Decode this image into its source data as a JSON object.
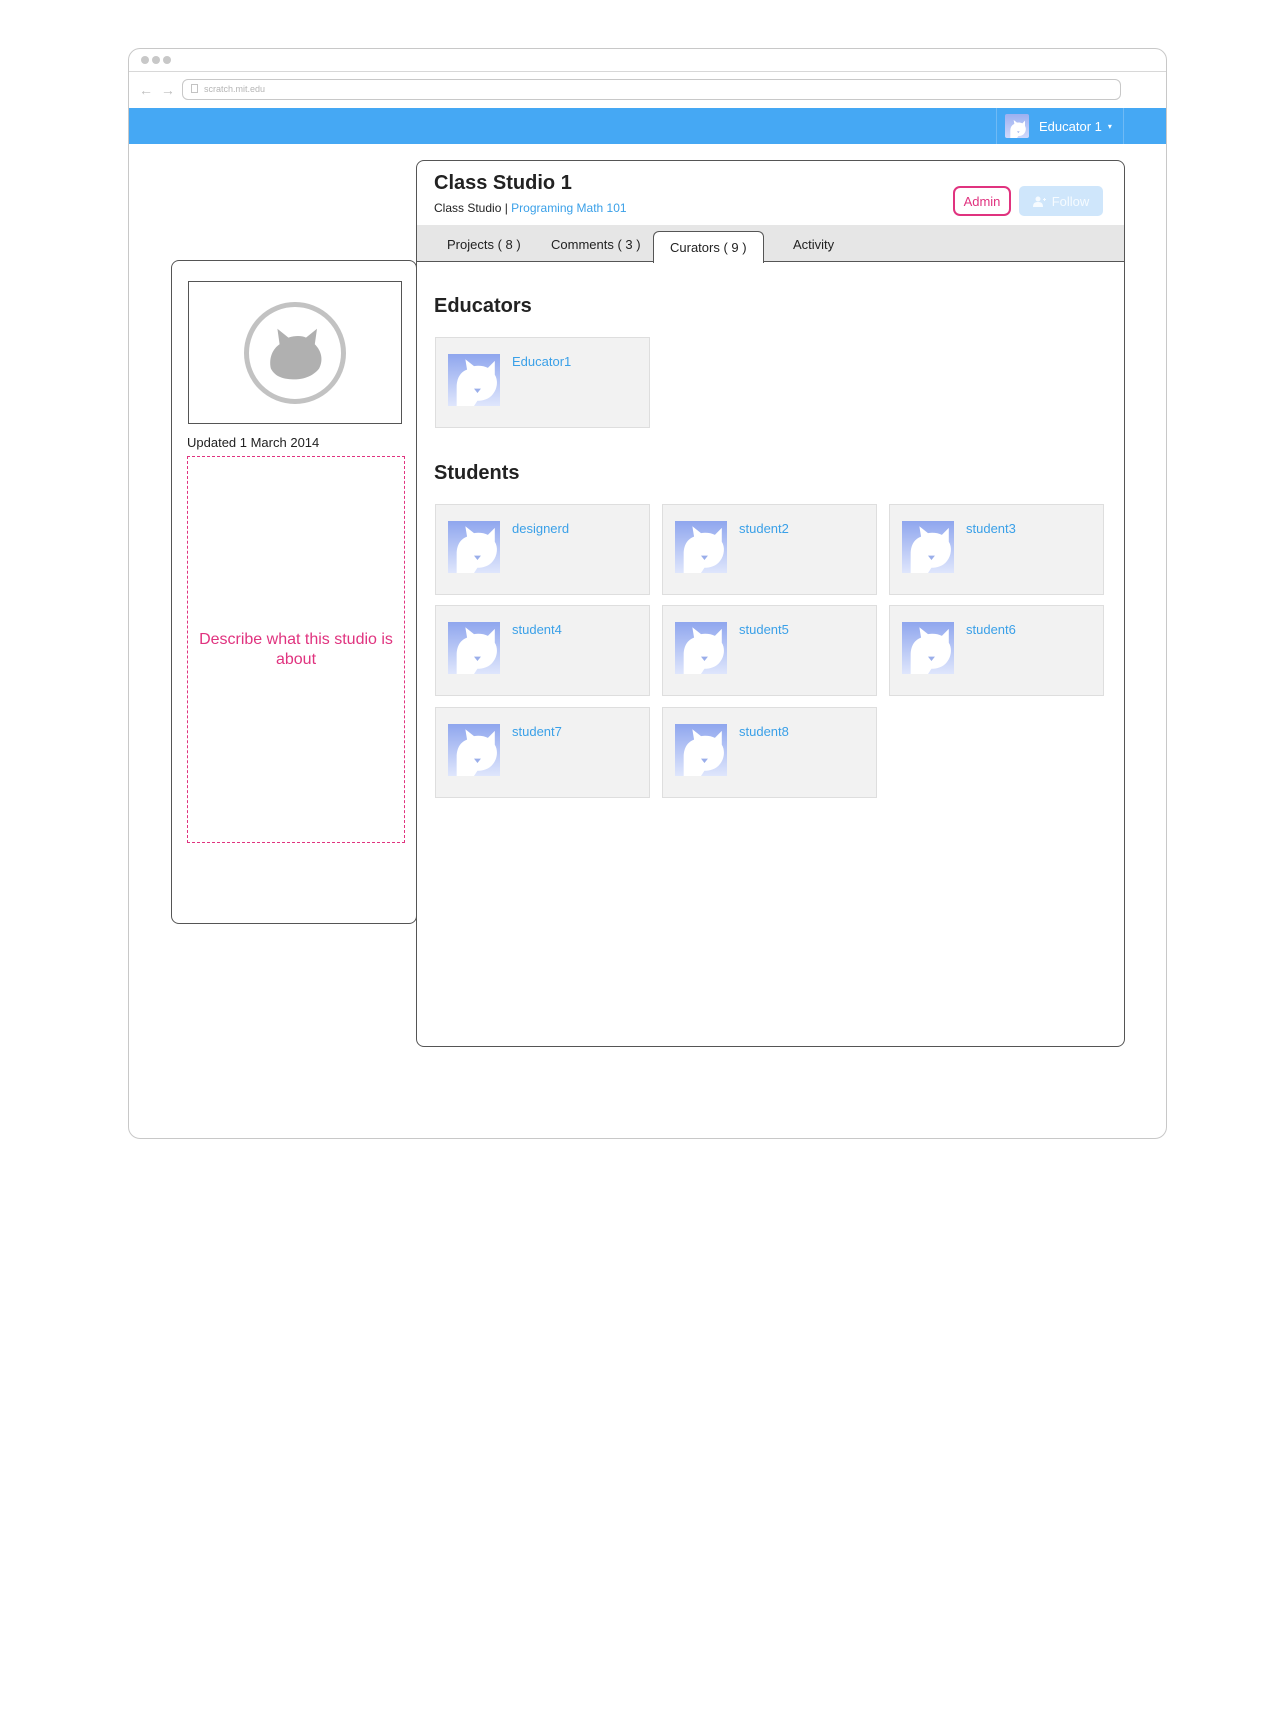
{
  "browser": {
    "url": "scratch.mit.edu",
    "nav_arrows": "← →"
  },
  "topbar": {
    "user_name": "Educator 1",
    "caret": "▾",
    "accent_color": "#45a8f4"
  },
  "sidebar": {
    "updated": "Updated 1 March 2014",
    "description_placeholder": "Describe what this studio is about"
  },
  "studio": {
    "title": "Class Studio 1",
    "type": "Class Studio",
    "separator": " | ",
    "class_link": "Programing Math 101",
    "admin_label": "Admin",
    "follow_label": "Follow"
  },
  "tabs": [
    {
      "label": "Projects ( 8 )"
    },
    {
      "label": "Comments ( 3 )"
    },
    {
      "label": "Curators ( 9 )",
      "active": true
    },
    {
      "label": "Activity"
    }
  ],
  "educators": {
    "heading": "Educators",
    "members": [
      {
        "name": "Educator1"
      }
    ]
  },
  "students": {
    "heading": "Students",
    "members": [
      {
        "name": "designerd"
      },
      {
        "name": "student2"
      },
      {
        "name": "student3"
      },
      {
        "name": "student4"
      },
      {
        "name": "student5"
      },
      {
        "name": "student6"
      },
      {
        "name": "student7"
      },
      {
        "name": "student8"
      }
    ]
  }
}
